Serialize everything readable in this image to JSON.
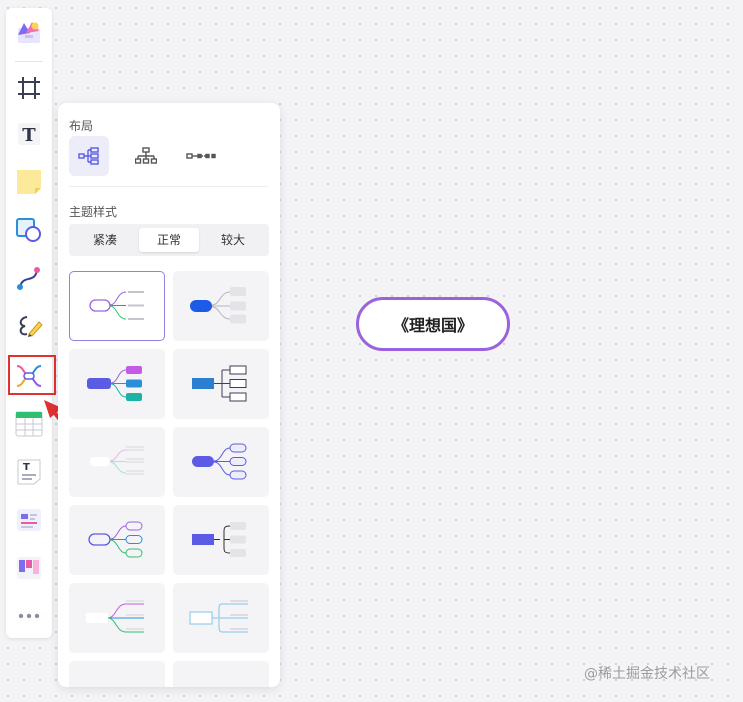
{
  "panel": {
    "layout_title": "布局",
    "theme_title": "主题样式",
    "density_options": [
      {
        "label": "紧凑",
        "active": false
      },
      {
        "label": "正常",
        "active": true
      },
      {
        "label": "较大",
        "active": false
      }
    ]
  },
  "canvas": {
    "node_text": "《理想国》"
  },
  "watermark": "@稀土掘金技术社区",
  "colors": {
    "node_border": "#9a63dd",
    "highlight": "#e03131",
    "accent": "#5b5be6"
  },
  "toolbar": {
    "tools": [
      "app-logo-icon",
      "frame-icon",
      "text-icon",
      "sticky-note-icon",
      "shape-icon",
      "connector-icon",
      "pen-icon",
      "mindmap-icon",
      "table-icon",
      "text-card-icon",
      "template-icon",
      "kanban-icon",
      "more-icon"
    ],
    "highlighted_tool": "mindmap-icon"
  }
}
